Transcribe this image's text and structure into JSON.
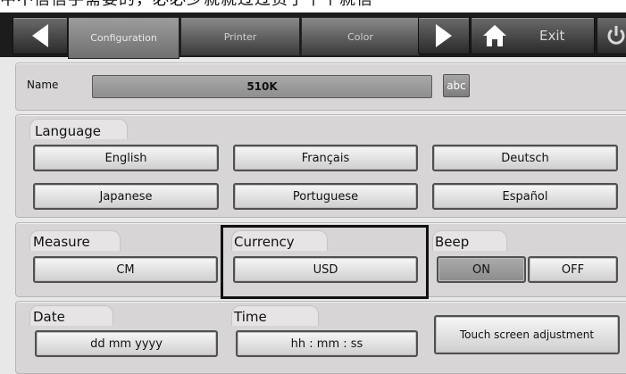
{
  "banner_text": "中不信信手需要的，必必少就就过过资于平个就信",
  "topbar": {
    "tabs": [
      {
        "label": "Configuration",
        "active": true
      },
      {
        "label": "Printer",
        "active": false
      },
      {
        "label": "Color",
        "active": false
      }
    ],
    "exit_label": "Exit"
  },
  "name": {
    "label": "Name",
    "value": "510K",
    "keyboard_button": "abc"
  },
  "language": {
    "label": "Language",
    "options": [
      "English",
      "Français",
      "Deutsch",
      "Japanese",
      "Portuguese",
      "Español"
    ]
  },
  "measure": {
    "label": "Measure",
    "value": "CM"
  },
  "currency": {
    "label": "Currency",
    "value": "USD"
  },
  "beep": {
    "label": "Beep",
    "on_label": "ON",
    "off_label": "OFF",
    "selected": "ON"
  },
  "date": {
    "label": "Date",
    "value": "dd mm yyyy"
  },
  "time": {
    "label": "Time",
    "value": "hh : mm : ss"
  },
  "touch_button": "Touch screen adjustment",
  "colors": {
    "topbar": "#1c1c1c",
    "panel": "#d7d5d5",
    "selected_button": "#9a9999"
  }
}
